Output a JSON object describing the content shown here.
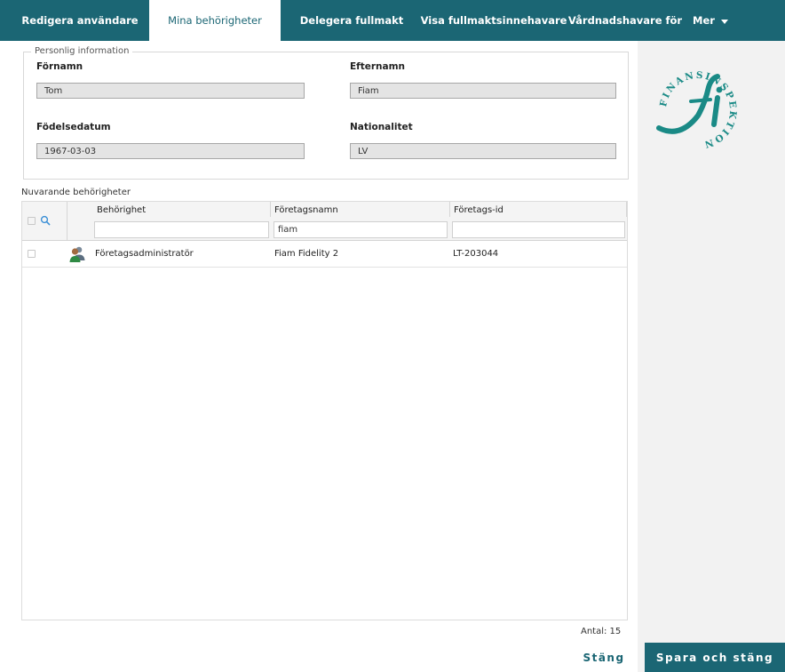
{
  "tabs": [
    {
      "label": "Redigera användare"
    },
    {
      "label": "Mina behörigheter"
    },
    {
      "label": "Delegera fullmakt"
    },
    {
      "label": "Visa fullmaktsinnehavare"
    },
    {
      "label": "Vårdnadshavare för"
    }
  ],
  "more_tab": {
    "label": "Mer"
  },
  "personal": {
    "legend": "Personlig information",
    "first_name_label": "Förnamn",
    "first_name_value": "Tom",
    "last_name_label": "Efternamn",
    "last_name_value": "Fiam",
    "birth_label": "Födelsedatum",
    "birth_value": "1967-03-03",
    "nationality_label": "Nationalitet",
    "nationality_value": "LV"
  },
  "logo": {
    "text": "FINANSINSPEKTIONEN",
    "mark": "fi",
    "color": "#1a8a86"
  },
  "permissions": {
    "title": "Nuvarande behörigheter",
    "columns": [
      "Behörighet",
      "Företagsnamn",
      "Företags-id"
    ],
    "filters": [
      "",
      "fiam",
      ""
    ],
    "rows": [
      {
        "permission": "Företagsadministratör",
        "company": "Fiam Fidelity 2",
        "company_id": "LT-203044"
      }
    ]
  },
  "footer": {
    "count": "Antal: 15",
    "close_label": "Stäng",
    "save_label": "Spara och stäng"
  },
  "colors": {
    "accent": "#1b6674",
    "logo": "#1a8a86"
  }
}
